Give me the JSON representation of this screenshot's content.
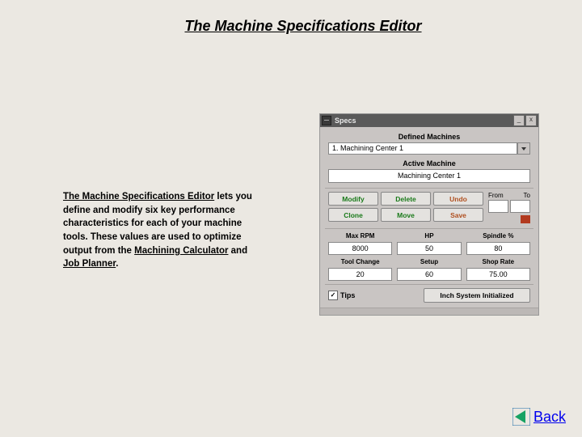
{
  "page": {
    "title": "The Machine Specifications Editor",
    "description": {
      "lead_underlined": "The Machine Specifications Editor",
      "part1": " lets you define and modify six key performance characteristics for  each of your machine tools.  These values are used to optimize output from the ",
      "mc_underlined": "Machining Calculator",
      "part2": " and ",
      "jp_underlined": "Job Planner",
      "end": "."
    }
  },
  "dialog": {
    "title": "Specs",
    "defined_label": "Defined Machines",
    "defined_value": "1.  Machining Center 1",
    "active_label": "Active Machine",
    "active_value": "Machining Center 1",
    "buttons": {
      "modify": "Modify",
      "delete": "Delete",
      "undo": "Undo",
      "clone": "Clone",
      "move": "Move",
      "save": "Save"
    },
    "fromto": {
      "from": "From",
      "to": "To"
    },
    "specs_row1": {
      "max_rpm_label": "Max RPM",
      "max_rpm_value": "8000",
      "hp_label": "HP",
      "hp_value": "50",
      "spindle_label": "Spindle %",
      "spindle_value": "80"
    },
    "specs_row2": {
      "tool_change_label": "Tool Change",
      "tool_change_value": "20",
      "setup_label": "Setup",
      "setup_value": "60",
      "shop_rate_label": "Shop Rate",
      "shop_rate_value": "75.00"
    },
    "tips_label": "Tips",
    "status": "Inch System Initialized"
  },
  "nav": {
    "back": "Back"
  }
}
